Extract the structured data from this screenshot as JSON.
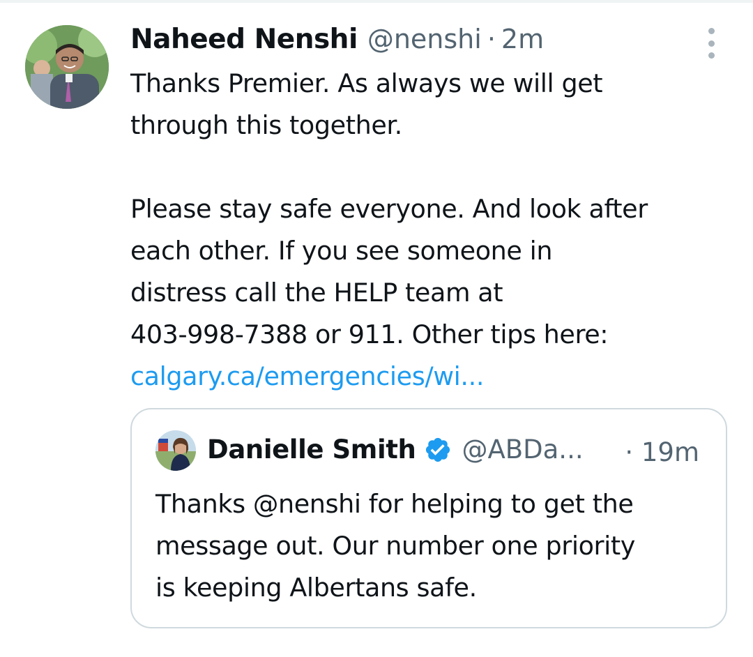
{
  "tweet": {
    "author_name": "Naheed Nenshi",
    "author_handle": "@nenshi",
    "separator": "·",
    "time": "2m",
    "text_paragraphs": [
      [
        "Thanks Premier. As always we will get",
        "through this together."
      ],
      [
        "Please stay safe everyone. And look after",
        "each other. If you see someone in",
        "distress call the HELP team at",
        "403-998-7388 or 911. Other tips here:"
      ]
    ],
    "link_text": "calgary.ca/emergencies/wi...",
    "more_icon": "more-vertical-icon"
  },
  "quoted_tweet": {
    "author_name": "Danielle Smith",
    "verified_icon": "verified-badge-icon",
    "author_handle": "@ABDa...",
    "time": "· 19m",
    "text_lines": [
      "Thanks @nenshi for helping to get the",
      "message out. Our number one priority",
      "is keeping Albertans safe."
    ]
  },
  "colors": {
    "text": "#0f1419",
    "secondary": "#536471",
    "link": "#1d9bf0",
    "border": "#cfd9de"
  }
}
